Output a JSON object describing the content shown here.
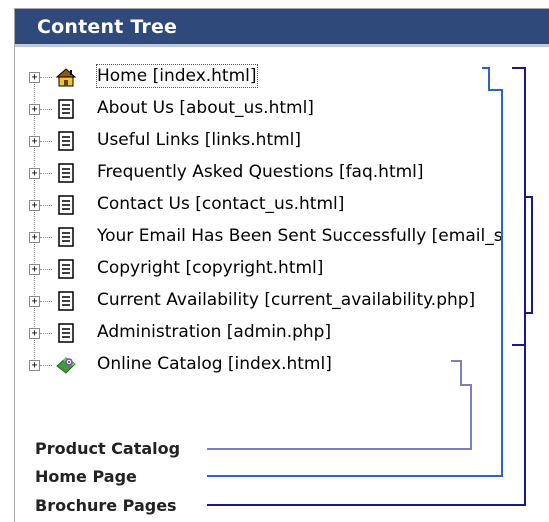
{
  "panel": {
    "title": "Content Tree"
  },
  "tree": {
    "items": [
      {
        "label": "Home [index.html]",
        "icon": "home-icon",
        "selected": true
      },
      {
        "label": "About Us [about_us.html]",
        "icon": "page-icon"
      },
      {
        "label": "Useful Links [links.html]",
        "icon": "page-icon"
      },
      {
        "label": "Frequently Asked Questions [faq.html]",
        "icon": "page-icon"
      },
      {
        "label": "Contact Us [contact_us.html]",
        "icon": "page-icon"
      },
      {
        "label": "Your Email Has Been Sent Successfully [email_s",
        "icon": "page-icon"
      },
      {
        "label": "Copyright [copyright.html]",
        "icon": "page-icon"
      },
      {
        "label": "Current Availability [current_availability.php]",
        "icon": "page-icon"
      },
      {
        "label": "Administration [admin.php]",
        "icon": "page-icon"
      },
      {
        "label": "Online Catalog [index.html]",
        "icon": "catalog-icon"
      }
    ]
  },
  "annotations": {
    "product_catalog": "Product Catalog",
    "home_page": "Home Page",
    "brochure_pages": "Brochure Pages"
  },
  "colors": {
    "titlebar": "#2f4a7a",
    "product_catalog_line": "#7f7fc0",
    "home_page_line": "#2a5fe0",
    "brochure_pages_line": "#1a1a8c"
  }
}
